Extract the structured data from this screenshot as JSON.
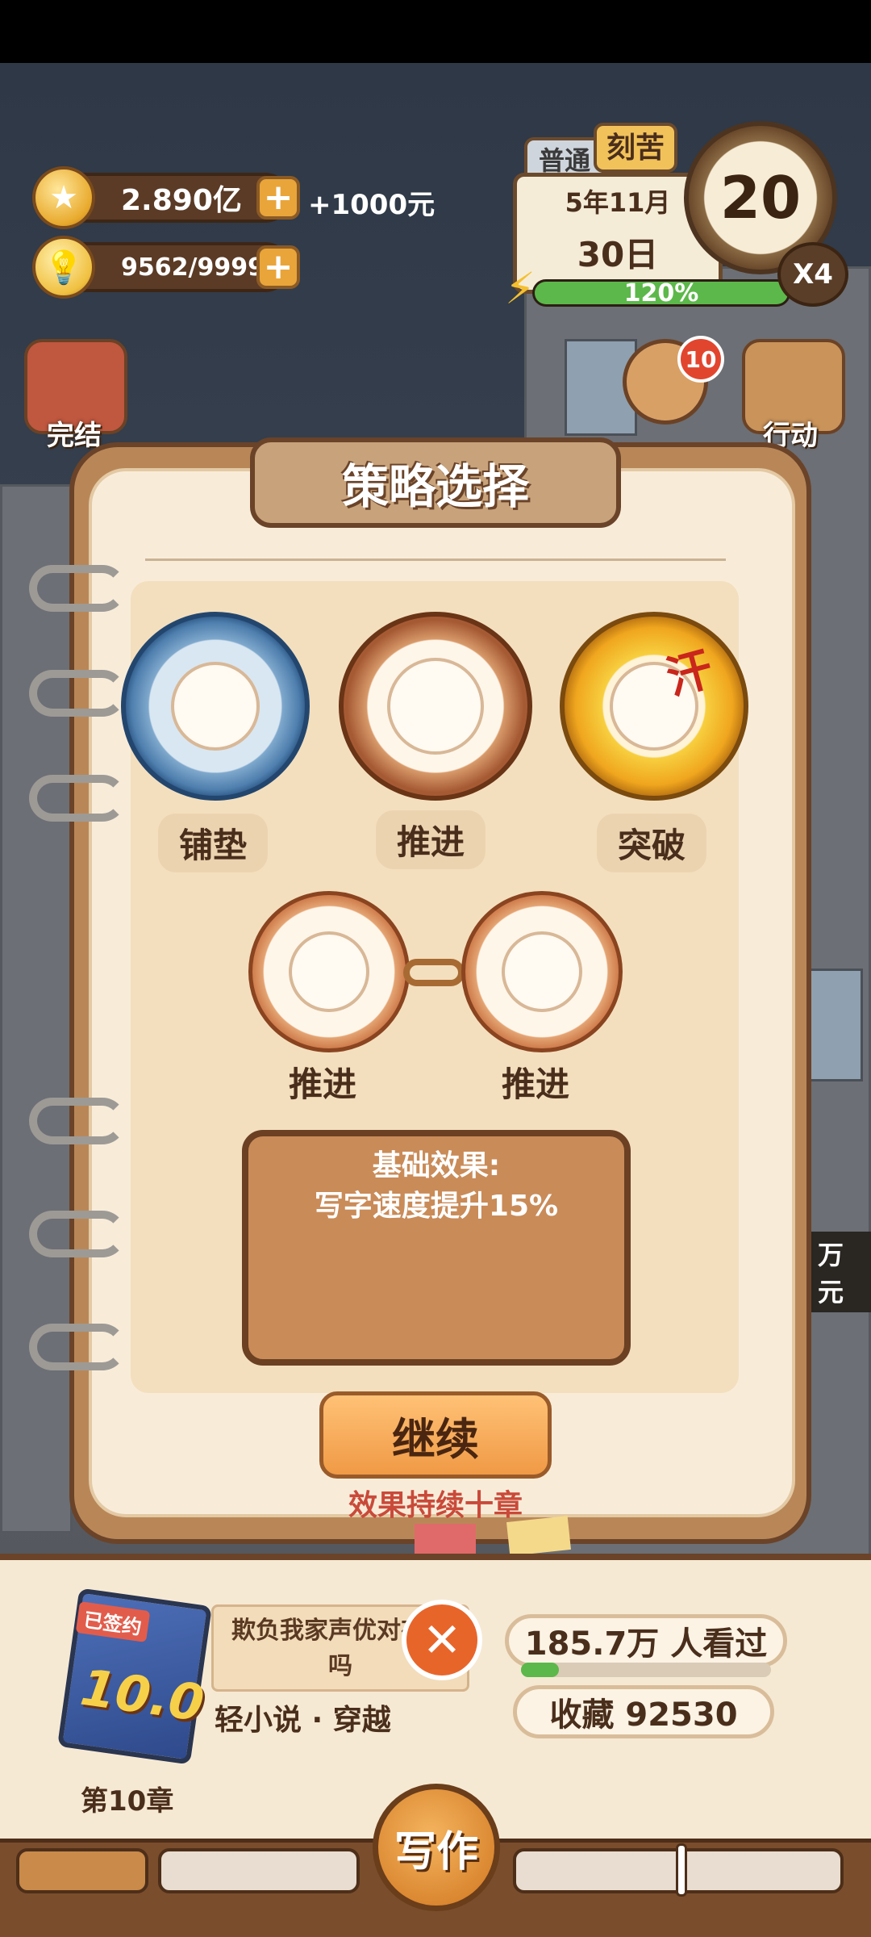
{
  "resources": {
    "coins": "2.890亿",
    "coin_income": "+1000元",
    "ideas": "9562/9999",
    "plus": "+"
  },
  "calendar": {
    "mode_inactive": "普通",
    "mode_active": "刻苦",
    "month": "5年11月",
    "day": "30日",
    "energy_percent": "120%",
    "energy_fill": 1.0,
    "timer_value": "20",
    "speed": "X4"
  },
  "side_menu": {
    "finish": "完结",
    "action": "行动",
    "badge_count": "10",
    "right_money": "万元"
  },
  "modal": {
    "title": "策略选择",
    "strategies": [
      {
        "label": "铺垫",
        "icon": "foreshadow-medal-icon"
      },
      {
        "label": "推进",
        "icon": "advance-medal-icon"
      },
      {
        "label": "突破",
        "icon": "breakthrough-medal-icon"
      }
    ],
    "selected": [
      {
        "label": "推进"
      },
      {
        "label": "推进"
      }
    ],
    "effect_title": "基础效果:",
    "effect_text": "写字速度提升15%",
    "continue_label": "继续",
    "duration_note": "效果持续十章",
    "breakthrough_char": "汗"
  },
  "book": {
    "cover_badge": "已签约",
    "cover_score": "10.0",
    "title": "欺负我家声优对有错吗",
    "genre": "轻小说 · 穿越",
    "chapter": "第10章",
    "views": "185.7万 人看过",
    "views_fill": 0.15,
    "favorites": "收藏 92530",
    "write_label": "写作"
  },
  "colors": {
    "accent": "#f09a45",
    "wood": "#6a4329",
    "energy_green": "#5cb84a",
    "note_red": "#c94a3a"
  }
}
